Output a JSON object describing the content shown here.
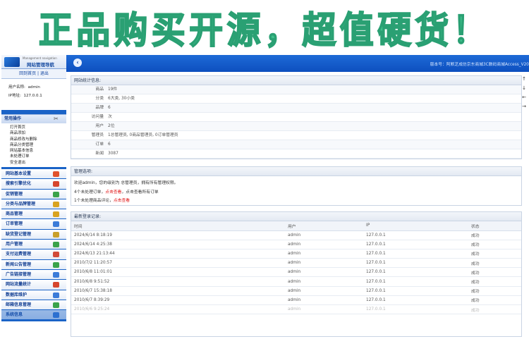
{
  "banner": {
    "text": "正品购买开源，超值硬货！"
  },
  "sidebar": {
    "logo_small": "Management navigation",
    "logo_title": "网站管理导航",
    "quick_links": "回到首页 | 退出",
    "user_label": "用户名称:",
    "user_value": "admin",
    "ip_label": "IP地址:",
    "ip_value": "127.0.0.1",
    "common_title": "常用操作",
    "common_items": [
      "打开首页",
      "商品添加",
      "商品修改与删除",
      "商品分类管理",
      "网站基本信息",
      "未处理订单",
      "安全退出"
    ],
    "menu": [
      {
        "label": "网站基本设置",
        "color": "#e0522c"
      },
      {
        "label": "搜索引擎优化",
        "color": "#d6462c"
      },
      {
        "label": "促销管理",
        "color": "#3aa34a"
      },
      {
        "label": "分类与品牌管理",
        "color": "#d9a320"
      },
      {
        "label": "商品管理",
        "color": "#d9a320"
      },
      {
        "label": "订单管理",
        "color": "#3b7bd8"
      },
      {
        "label": "缺货登记管理",
        "color": "#c9a02a"
      },
      {
        "label": "用户管理",
        "color": "#3aa34a"
      },
      {
        "label": "支付运费管理",
        "color": "#d14b3a"
      },
      {
        "label": "新闻公告管理",
        "color": "#3aa34a"
      },
      {
        "label": "广告链接管理",
        "color": "#3b7bd8"
      },
      {
        "label": "网站流量统计",
        "color": "#d6462c"
      },
      {
        "label": "数据库维护",
        "color": "#3b7bd8"
      },
      {
        "label": "邮箱信息管理",
        "color": "#3aa34a"
      },
      {
        "label": "系统信息",
        "color": "#3b7bd8"
      }
    ]
  },
  "topbar": {
    "version": "版本号：阿默芝成仿京东商城3C数码商城Access_V20"
  },
  "stats": {
    "title": "网站统计信息:",
    "rows": [
      {
        "k": "商品",
        "v": "19件"
      },
      {
        "k": "分类",
        "v": "6大类, 30小类"
      },
      {
        "k": "品牌",
        "v": "6"
      },
      {
        "k": "访问量",
        "v": "次"
      },
      {
        "k": "用户",
        "v": "2位"
      },
      {
        "k": "管理员",
        "v": "1总管理员, 0商品管理员, 0订单管理员"
      },
      {
        "k": "订单",
        "v": "6"
      },
      {
        "k": "新闻",
        "v": "3087"
      }
    ]
  },
  "mgmt": {
    "title": "管理选项:",
    "line1": "欢迎admin，您的级别为 总管理员，拥有所有管理权限。",
    "line2_pre": "4个未处理订单，",
    "line2_link": "点击查看",
    "line2_post": "，点击查看所有订单",
    "line3_pre": "1个未处理商品评论，",
    "line3_link": "点击查看"
  },
  "logins": {
    "title": "最新登录记录:",
    "headers": [
      "时间",
      "用户",
      "IP",
      "状态"
    ],
    "rows": [
      [
        "2024/6/14 8:18:19",
        "admin",
        "127.0.0.1",
        "成功"
      ],
      [
        "2024/6/14 4:25:38",
        "admin",
        "127.0.0.1",
        "成功"
      ],
      [
        "2024/6/13 21:13:44",
        "admin",
        "127.0.0.1",
        "成功"
      ],
      [
        "2010/7/2 11:20:57",
        "admin",
        "127.0.0.1",
        "成功"
      ],
      [
        "2010/6/8 11:01:01",
        "admin",
        "127.0.0.1",
        "成功"
      ],
      [
        "2010/6/8 9:51:52",
        "admin",
        "127.0.0.1",
        "成功"
      ],
      [
        "2010/6/7 15:38:18",
        "admin",
        "127.0.0.1",
        "成功"
      ],
      [
        "2010/6/7 8:39:29",
        "admin",
        "127.0.0.1",
        "成功"
      ],
      [
        "2010/6/6 9:25:24",
        "admin",
        "127.0.0.1",
        "成功"
      ]
    ]
  }
}
